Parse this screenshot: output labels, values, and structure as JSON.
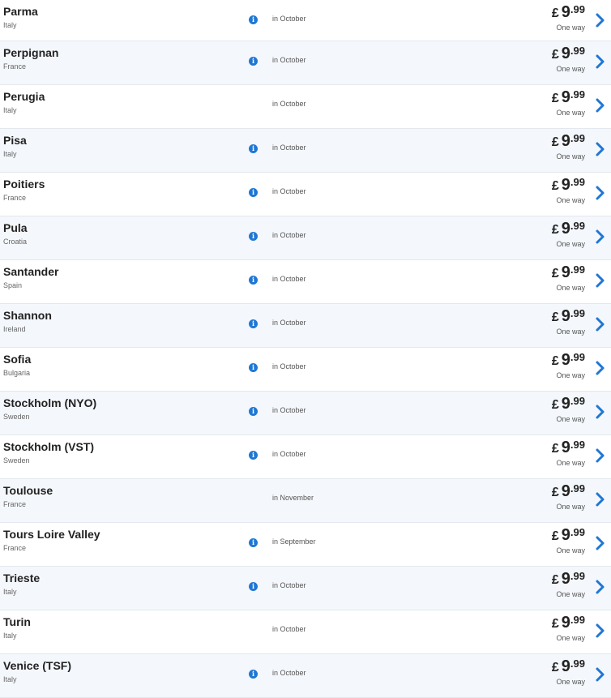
{
  "routes": [
    {
      "city": "Parma",
      "country": "Italy",
      "info": true,
      "when": "in October",
      "currency": "£",
      "units": "9",
      "cents": ".99",
      "fare_type": "One way"
    },
    {
      "city": "Perpignan",
      "country": "France",
      "info": true,
      "when": "in October",
      "currency": "£",
      "units": "9",
      "cents": ".99",
      "fare_type": "One way"
    },
    {
      "city": "Perugia",
      "country": "Italy",
      "info": false,
      "when": "in October",
      "currency": "£",
      "units": "9",
      "cents": ".99",
      "fare_type": "One way"
    },
    {
      "city": "Pisa",
      "country": "Italy",
      "info": true,
      "when": "in October",
      "currency": "£",
      "units": "9",
      "cents": ".99",
      "fare_type": "One way"
    },
    {
      "city": "Poitiers",
      "country": "France",
      "info": true,
      "when": "in October",
      "currency": "£",
      "units": "9",
      "cents": ".99",
      "fare_type": "One way"
    },
    {
      "city": "Pula",
      "country": "Croatia",
      "info": true,
      "when": "in October",
      "currency": "£",
      "units": "9",
      "cents": ".99",
      "fare_type": "One way"
    },
    {
      "city": "Santander",
      "country": "Spain",
      "info": true,
      "when": "in October",
      "currency": "£",
      "units": "9",
      "cents": ".99",
      "fare_type": "One way"
    },
    {
      "city": "Shannon",
      "country": "Ireland",
      "info": true,
      "when": "in October",
      "currency": "£",
      "units": "9",
      "cents": ".99",
      "fare_type": "One way"
    },
    {
      "city": "Sofia",
      "country": "Bulgaria",
      "info": true,
      "when": "in October",
      "currency": "£",
      "units": "9",
      "cents": ".99",
      "fare_type": "One way"
    },
    {
      "city": "Stockholm (NYO)",
      "country": "Sweden",
      "info": true,
      "when": "in October",
      "currency": "£",
      "units": "9",
      "cents": ".99",
      "fare_type": "One way"
    },
    {
      "city": "Stockholm (VST)",
      "country": "Sweden",
      "info": true,
      "when": "in October",
      "currency": "£",
      "units": "9",
      "cents": ".99",
      "fare_type": "One way"
    },
    {
      "city": "Toulouse",
      "country": "France",
      "info": false,
      "when": "in November",
      "currency": "£",
      "units": "9",
      "cents": ".99",
      "fare_type": "One way"
    },
    {
      "city": "Tours Loire Valley",
      "country": "France",
      "info": true,
      "when": "in September",
      "currency": "£",
      "units": "9",
      "cents": ".99",
      "fare_type": "One way"
    },
    {
      "city": "Trieste",
      "country": "Italy",
      "info": true,
      "when": "in October",
      "currency": "£",
      "units": "9",
      "cents": ".99",
      "fare_type": "One way"
    },
    {
      "city": "Turin",
      "country": "Italy",
      "info": false,
      "when": "in October",
      "currency": "£",
      "units": "9",
      "cents": ".99",
      "fare_type": "One way"
    },
    {
      "city": "Venice (TSF)",
      "country": "Italy",
      "info": true,
      "when": "in October",
      "currency": "£",
      "units": "9",
      "cents": ".99",
      "fare_type": "One way"
    }
  ],
  "icons": {
    "info": "info-icon",
    "chevron": "chevron-right-icon"
  },
  "colors": {
    "accent": "#1f77d4",
    "row_alt_background": "#f4f7fb",
    "divider": "#e3e8ee"
  }
}
